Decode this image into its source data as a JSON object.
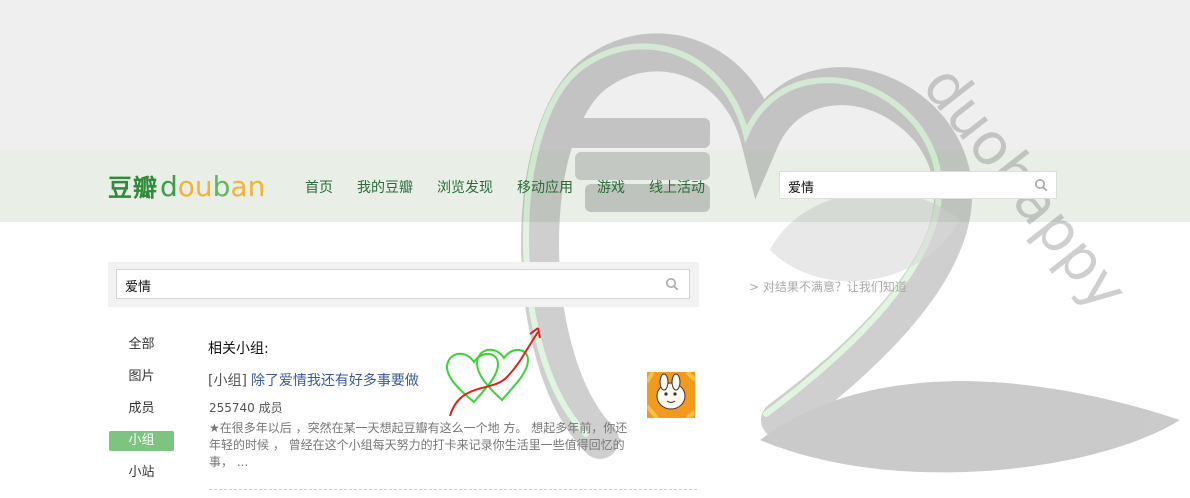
{
  "header": {
    "logo_cn": "豆瓣",
    "logo_en": [
      "d",
      "o",
      "u",
      "b",
      "a",
      "n"
    ],
    "nav": [
      "首页",
      "我的豆瓣",
      "浏览发现",
      "移动应用",
      "游戏",
      "线上活动"
    ],
    "search_value": "爱情"
  },
  "main_search": {
    "value": "爱情"
  },
  "feedback": "> 对结果不满意？让我们知道",
  "sidebar": {
    "items": [
      "全部",
      "图片",
      "成员",
      "小组",
      "小站"
    ],
    "active": "小组"
  },
  "results": {
    "heading": "相关小组:",
    "group": {
      "tag": "[小组]",
      "title": "除了爱情我还有好多事要做",
      "members": "255740 成员",
      "description": "★在很多年以后 ，突然在某一天想起豆瓣有这么一个地 方。 想起多年前，你还年轻的时候 ， 曾经在这个小组每天努力的打卡来记录你生活里一些值得回忆的事， ..."
    }
  },
  "watermark": {
    "text": "duohappy"
  },
  "colors": {
    "brand_green": "#2e8b3a",
    "active_tab": "#7cc47f",
    "link_blue": "#3a5a9a"
  }
}
